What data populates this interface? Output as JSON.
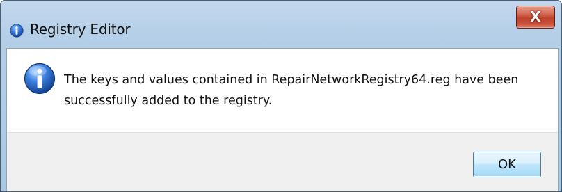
{
  "window": {
    "title": "Registry Editor",
    "close_label": "X"
  },
  "dialog": {
    "icon": "information-icon",
    "message": "The keys and values contained in RepairNetworkRegistry64.reg have been successfully added to the registry.",
    "ok_label": "OK"
  },
  "colors": {
    "titlebar": "#b5cfe8",
    "close_button": "#c0412a",
    "info_icon": "#1f5fbf",
    "footer": "#f0f0f0"
  }
}
